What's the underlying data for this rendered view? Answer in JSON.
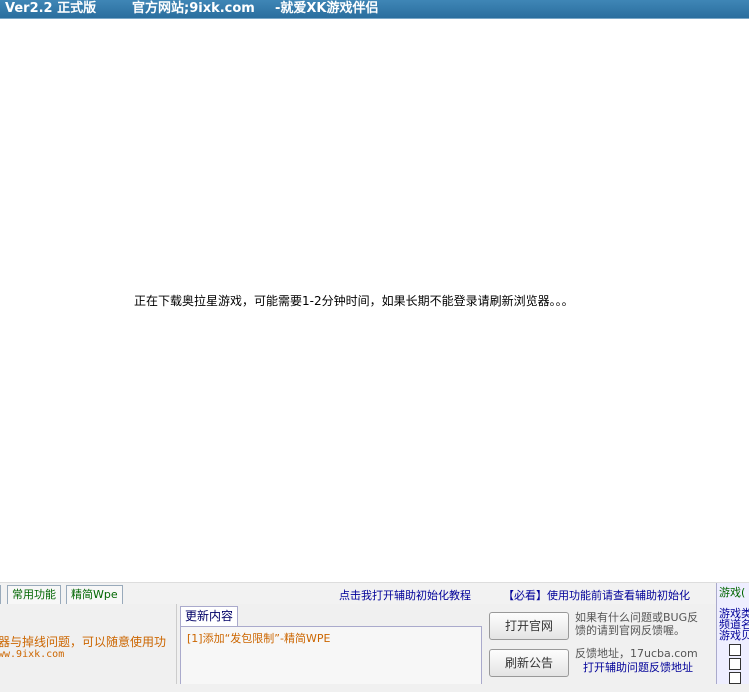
{
  "title": {
    "version": "Ver2.2 正式版",
    "site": "官方网站;9ixk.com",
    "slogan": "-就爱XK游戏伴侣"
  },
  "main": {
    "loading_text": "正在下载奥拉星游戏，可能需要1-2分钟时间，如果长期不能登录请刷新浏览器。。。"
  },
  "tabs": {
    "common": "常用功能",
    "wpe": "精简Wpe"
  },
  "links": {
    "tutorial": "点击我打开辅助初始化教程",
    "must_read": "【必看】使用功能前请查看辅助初始化"
  },
  "left_panel": {
    "text": "器与掉线问题，可以随意使用功",
    "url": "ww.9ixk.com"
  },
  "update": {
    "tab_label": "更新内容",
    "line1": "[1]添加“发包限制”-精简WPE"
  },
  "buttons": {
    "official_site": "打开官网",
    "refresh_notice": "刷新公告"
  },
  "feedback": {
    "line1": "如果有什么问题或BUG反",
    "line2": "馈的请到官网反馈喔。",
    "address": "反馈地址，17ucba.com",
    "open_link": "打开辅助问题反馈地址"
  },
  "right_panel": {
    "tab": "游戏(",
    "l1": "游戏类",
    "l2": "频道名",
    "l3": "游戏贝"
  },
  "colors": {
    "titlebar": "#2a6e9e",
    "link": "#000099",
    "update_text": "#cc6600"
  }
}
